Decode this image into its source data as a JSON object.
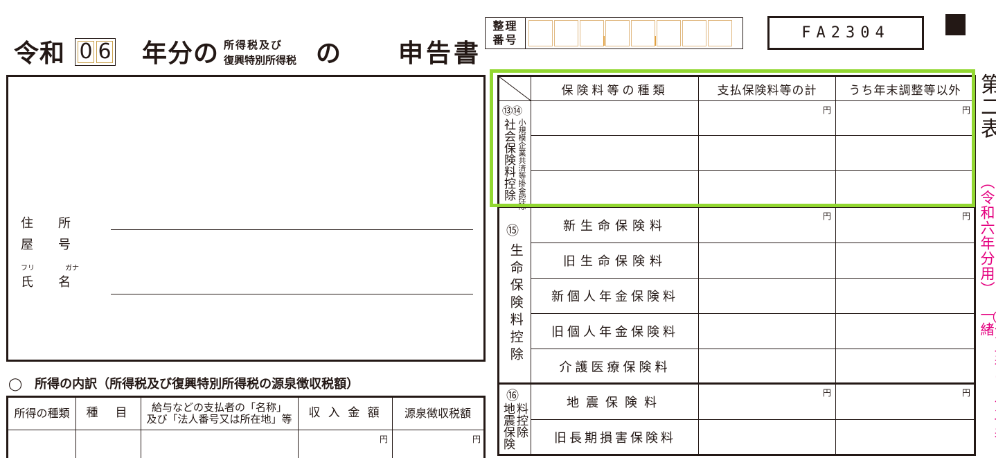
{
  "title": {
    "reiwa": "令和",
    "year_digits": [
      "0",
      "6"
    ],
    "nenbun_no": "年分の",
    "tax_line1": "所得税及び",
    "tax_line2": "復興特別所得税",
    "no": "の",
    "shinkokusho": "申告書"
  },
  "seiri": {
    "label_line1": "整理",
    "label_line2": "番号"
  },
  "form_code": "FA2304",
  "address": {
    "jusho": "住　　所",
    "yago": "屋　　号",
    "furi": "フリ",
    "gana": "ガナ",
    "shimei": "氏　　名"
  },
  "income": {
    "heading": "◯　所得の内訳（所得税及び復興特別所得税の源泉徴収税額）",
    "headers": [
      "所得の種類",
      "種　目",
      "給与などの支払者の「名称」\n及び「法人番号又は所在地」等",
      "収 入 金 額",
      "源泉徴収税額"
    ],
    "yen": "円"
  },
  "deductions": {
    "headers": [
      "保険料等の種類",
      "支払保険料等の計",
      "うち年末調整等以外"
    ],
    "yen": "円",
    "social": {
      "circle_labels": "⑬⑭",
      "label_main": "社会保険料控除",
      "label_sub": "小規模企業共済等掛金控除"
    },
    "life": {
      "circle_label": "⑮",
      "label": "生命保険料控除",
      "items": [
        "新生命保険料",
        "旧生命保険料",
        "新個人年金保険料",
        "旧個人年金保険料",
        "介護医療保険料"
      ]
    },
    "earthquake": {
      "circle_label": "⑯",
      "label_col1": "地震保険",
      "label_col2": "料控除",
      "items": [
        "地震保険料",
        "旧長期損害保険料"
      ]
    }
  },
  "side": {
    "title": "第二表",
    "subtitle": "（令和六年分用）",
    "note": "◯第二表は、第一表と一緒"
  }
}
